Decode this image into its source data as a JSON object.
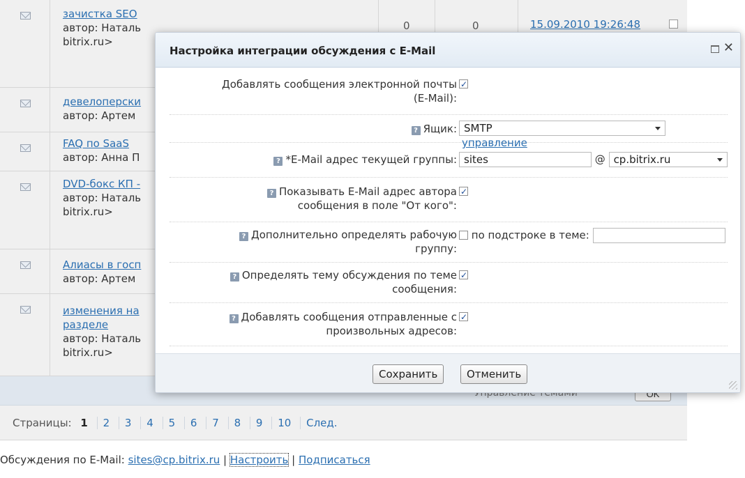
{
  "forum": {
    "rows": [
      {
        "title": "зачистка SEO",
        "author": "автор: Наталь",
        "extra": "bitrix.ru>",
        "count1": "0",
        "count2": "0",
        "date": "15.09.2010 19:26:48"
      },
      {
        "title": "девелоперски",
        "author": "автор: Артем"
      },
      {
        "title": "FAQ по SaaS",
        "author": "автор: Анна П"
      },
      {
        "title": "DVD-бокс КП -",
        "author": "автор: Наталь",
        "extra": "bitrix.ru>"
      },
      {
        "title": "Алиасы в госп",
        "author": "автор: Артем"
      },
      {
        "title": "изменения на",
        "title2": "разделе",
        "author": "автор: Наталь",
        "extra": "bitrix.ru>"
      }
    ],
    "footer_select": "Управление темами",
    "ok_button": "OK"
  },
  "pager": {
    "label": "Страницы:",
    "pages": [
      "1",
      "2",
      "3",
      "4",
      "5",
      "6",
      "7",
      "8",
      "9",
      "10"
    ],
    "current": "1",
    "next": "След."
  },
  "email_line": {
    "prefix": "Обсуждения по E-Mail:",
    "address": "sites@cp.bitrix.ru",
    "sep1": "|",
    "configure": "Настроить",
    "sep2": "|",
    "subscribe": "Подписаться"
  },
  "dialog": {
    "title": "Настройка интеграции обсуждения с E-Mail",
    "close_glyph": "✕",
    "fields": {
      "add_messages": {
        "label_line1": "Добавлять сообщения электронной почты",
        "label_line2": "(E-Mail):",
        "checked": true
      },
      "mailbox": {
        "label": "Ящик:",
        "value": "SMTP",
        "manage_link": "управление"
      },
      "group_email": {
        "label": "*E-Mail адрес текущей группы:",
        "local": "sites",
        "at": "@",
        "domain": "cp.bitrix.ru"
      },
      "show_author": {
        "label_line1": "Показывать E-Mail адрес автора",
        "label_line2": "сообщения в поле \"От кого\":",
        "checked": true
      },
      "detect_group": {
        "label_line1": "Дополнительно определять рабочую",
        "label_line2": "группу:",
        "checked": false,
        "substring_label": "по подстроке в теме:",
        "substring_value": ""
      },
      "detect_topic": {
        "label_line1": "Определять тему обсуждения по теме",
        "label_line2": "сообщения:",
        "checked": true
      },
      "arbitrary": {
        "label_line1": "Добавлять сообщения отправленные с",
        "label_line2": "произвольных адресов:",
        "checked": true
      }
    },
    "save_button": "Сохранить",
    "cancel_button": "Отменить"
  }
}
